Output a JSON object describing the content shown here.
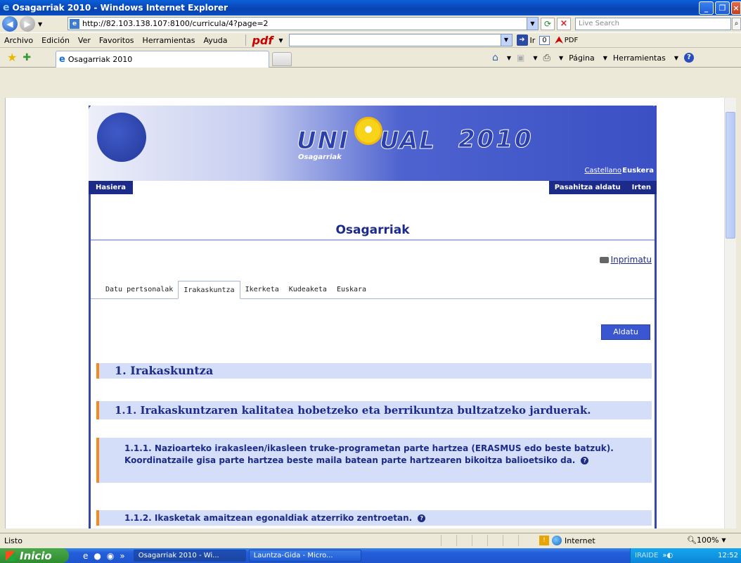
{
  "window": {
    "title": "Osagarriak 2010 - Windows Internet Explorer"
  },
  "address": {
    "url": "http://82.103.138.107:8100/curricula/4?page=2",
    "search_placeholder": "Live Search"
  },
  "menu": {
    "items": [
      "Archivo",
      "Edición",
      "Ver",
      "Favoritos",
      "Herramientas",
      "Ayuda"
    ],
    "pdf_label": "pdf",
    "ir_label": "Ir",
    "count": "0",
    "pdf_button": "PDF"
  },
  "tabbar": {
    "tab_title": "Osagarriak 2010",
    "pagina_label": "Página",
    "herramientas_label": "Herramientas"
  },
  "site": {
    "logo_uni": "UNI",
    "logo_ual": "UAL",
    "logo_year": "2010",
    "logo_sub": "Osagarriak",
    "lang_castellano": "Castellano",
    "lang_euskera": "Euskera",
    "nav_home": "Hasiera",
    "nav_password": "Pasahitza aldatu",
    "nav_exit": "Irten"
  },
  "content": {
    "page_title": "Osagarriak",
    "print_label": "Inprimatu",
    "tabs": [
      {
        "label": "Datu pertsonalak"
      },
      {
        "label": "Irakaskuntza"
      },
      {
        "label": "Ikerketa"
      },
      {
        "label": "Kudeaketa"
      },
      {
        "label": "Euskara"
      }
    ],
    "edit_button": "Aldatu",
    "sections": [
      {
        "text": "1. Irakaskuntza"
      },
      {
        "text": "1.1. Irakaskuntzaren kalitatea hobetzeko eta berrikuntza bultzatzeko jarduerak."
      },
      {
        "text": "1.1.1. Nazioarteko irakasleen/ikasleen truke-programetan parte hartzea (ERASMUS edo beste batzuk). Koordinatzaile gisa parte hartzea beste maila batean parte hartzearen bikoitza balioetsiko da."
      },
      {
        "text": "1.1.2. Ikasketak amaitzean egonaldiak atzerriko zentroetan."
      }
    ]
  },
  "status": {
    "text": "Listo",
    "zone": "Internet",
    "zoom": "100%"
  },
  "taskbar": {
    "start": "Inicio",
    "items": [
      "Osagarriak 2010 - Wi...",
      "Launtza-Gida - Micro..."
    ],
    "user": "IRAIDE",
    "clock": "12:52"
  },
  "colors": {
    "accent_blue": "#1c2a8a",
    "section_bg": "#d5def8",
    "section_border": "#f28a20",
    "button_blue": "#3a56d0"
  }
}
